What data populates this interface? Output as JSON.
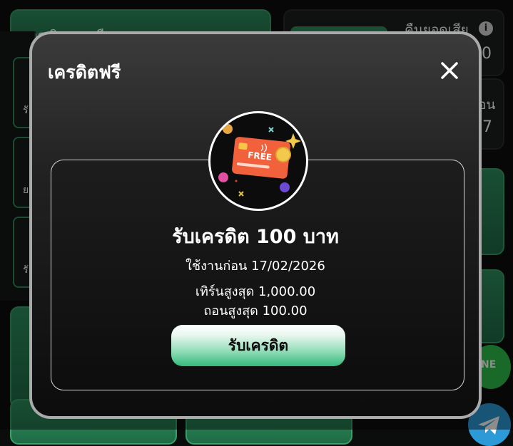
{
  "background": {
    "balance_label": "ยอดเงินคงเหลือ",
    "cashback_label": "คืนยอดเสีย",
    "cashback_value_partial": "0",
    "second_label_partial": "อน",
    "second_value_partial": "7",
    "info_icon_glyph": "i",
    "side_items": [
      "รั",
      "ย",
      "รั"
    ],
    "line_button_text": "NE"
  },
  "modal": {
    "title": "เครดิตฟรี",
    "close_icon": "close-icon",
    "badge": {
      "icon": "free-credit-card-icon",
      "card_text": "FREE"
    },
    "offer_title": "รับเครดิต 100 บาท",
    "expiry_text": "ใช้งานก่อน 17/02/2026",
    "max_deposit_text": "เทิร์นสูงสุด 1,000.00",
    "max_withdraw_text": "ถอนสูงสุด 100.00",
    "claim_button_label": "รับเครดิต"
  },
  "colors": {
    "accent_green": "#34b97b",
    "modal_border": "#a9aaa9",
    "line_green": "#2fbf4a",
    "telegram_blue": "#2b9ad6"
  }
}
